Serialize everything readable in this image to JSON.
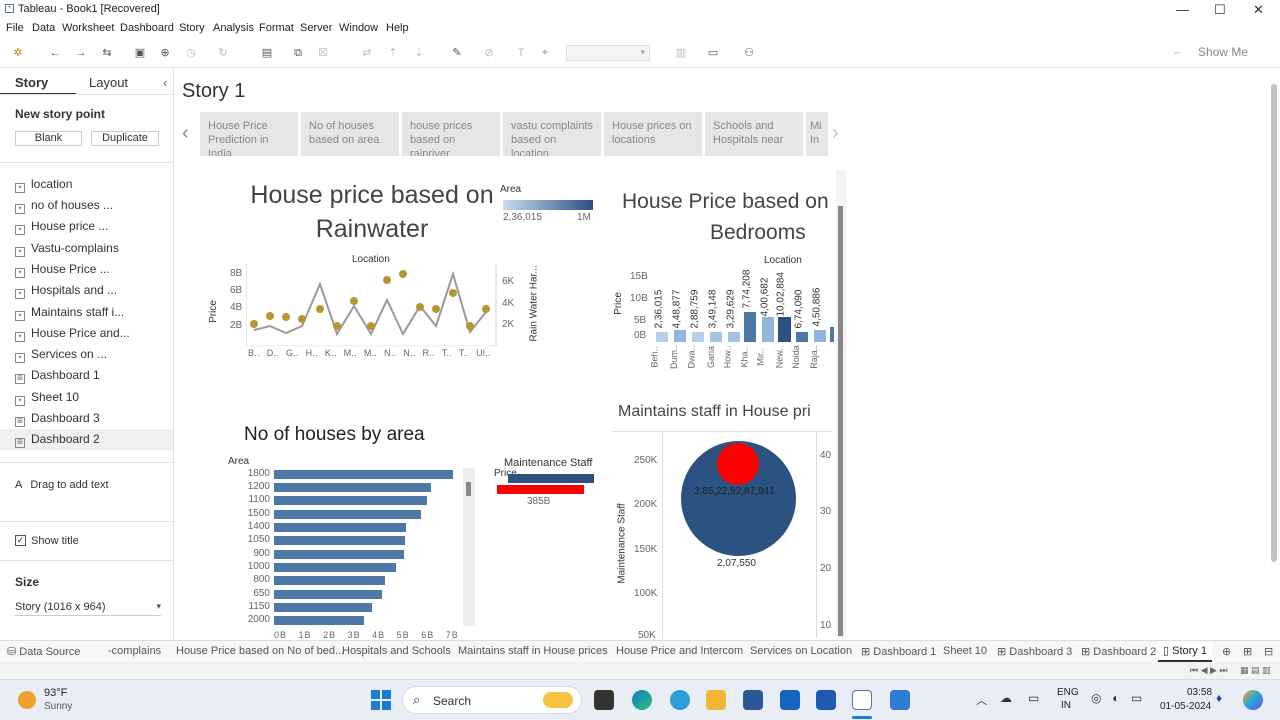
{
  "window": {
    "title": "Tableau - Book1 [Recovered]",
    "minimize": "—",
    "maximize": "☐",
    "close": "✕"
  },
  "menu": [
    "File",
    "Data",
    "Worksheet",
    "Dashboard",
    "Story",
    "Analysis",
    "Format",
    "Server",
    "Window",
    "Help"
  ],
  "toolbar": {
    "show_me": "Show Me"
  },
  "left_pane": {
    "tab_story": "Story",
    "tab_layout": "Layout",
    "collapse": "‹",
    "new_story_point": "New story point",
    "blank": "Blank",
    "duplicate": "Duplicate",
    "sheets": [
      "location",
      "no of houses ...",
      "House price ...",
      "Vastu-complains",
      "House Price ...",
      "Hospitals and ...",
      "Maintains staff i...",
      "House Price and...",
      "Services on ...",
      "Dashboard 1",
      "Sheet 10",
      "Dashboard 3",
      "Dashboard 2"
    ],
    "drag_text": "Drag to add text",
    "show_title": "Show title",
    "size_label": "Size",
    "size_value": "Story (1016 x 964)"
  },
  "story": {
    "title": "Story 1",
    "points": [
      "House Price Prediction in India",
      "No of houses based on area",
      "house prices based on rainriver",
      "vastu complaints based on location",
      "House prices on locations",
      "Schools and Hospitals near",
      "Mi In"
    ]
  },
  "chart_rain": {
    "title_line1": "House price based on",
    "title_line2": "Rainwater",
    "legend_title": "Area",
    "legend_min": "2,36,015",
    "legend_max": "1M",
    "x_header": "Location",
    "y_label": "Price",
    "y2_label": "Rain Water Har...",
    "y_ticks": [
      "8B",
      "6B",
      "4B",
      "2B"
    ],
    "y2_ticks": [
      "6K",
      "4K",
      "2K"
    ],
    "x_ticks": [
      "B..",
      "D..",
      "G..",
      "H..",
      "K..",
      "M..",
      "M..",
      "N..",
      "N..",
      "R..",
      "T..",
      "T..",
      "Ul.."
    ]
  },
  "chart_bed": {
    "title_line1": "House Price based on",
    "title_line2": "Bedrooms",
    "x_header": "Location",
    "y_label": "Price",
    "y_ticks": [
      "15B",
      "10B",
      "5B",
      "0B"
    ],
    "value_labels": [
      "2,36,015",
      "4,48,877",
      "2,88,759",
      "3,49,148",
      "3,29,629",
      "7,74,208",
      "4,00,682",
      "10,02,884",
      "6,74,090",
      "4,50,886"
    ],
    "categories": [
      "Beh..",
      "Dum..",
      "Dwa..",
      "Garia",
      "How..",
      "Kha..",
      "Mir..",
      "New..",
      "Noida",
      "Raja.."
    ]
  },
  "chart_area": {
    "title": "No of houses by area",
    "row_header": "Area",
    "categories": [
      "1800",
      "1200",
      "1100",
      "1500",
      "1400",
      "1050",
      "900",
      "1000",
      "800",
      "650",
      "1150",
      "2000"
    ],
    "legend_title": "Maintenance Staff",
    "legend_price": "Price",
    "legend_val": "385B",
    "x_ticks": [
      "0B",
      "1B",
      "2B",
      "3B",
      "4B",
      "5B",
      "6B",
      "7B"
    ]
  },
  "chart_staff": {
    "title": "Maintains staff in House pri",
    "y_label": "Maintenance Staff",
    "y_ticks": [
      "250K",
      "200K",
      "150K",
      "100K",
      "50K"
    ],
    "y2_ticks": [
      "40",
      "30",
      "20",
      "10"
    ],
    "bubble_label": "3,85,22,92,87,941",
    "bubble_value": "2,07,550"
  },
  "tabs": [
    "Data Source",
    "-complains",
    "House Price based on No of bed...",
    "Hospitals and Schools",
    "Maintains staff in House prices",
    "House Price and Intercom",
    "Services on Location",
    "Dashboard 1",
    "Sheet 10",
    "Dashboard 3",
    "Dashboard 2",
    "Story 1"
  ],
  "taskbar": {
    "weather_temp": "93°F",
    "weather_desc": "Sunny",
    "search": "Search",
    "lang1": "ENG",
    "lang2": "IN",
    "time": "03:58",
    "date": "01-05-2024"
  },
  "colors": {
    "bar": "#4e79a7",
    "dark": "#2c5282",
    "light": "#8fb5d9",
    "red": "#ff0000",
    "gold": "#b8962e",
    "line": "#999999"
  }
}
